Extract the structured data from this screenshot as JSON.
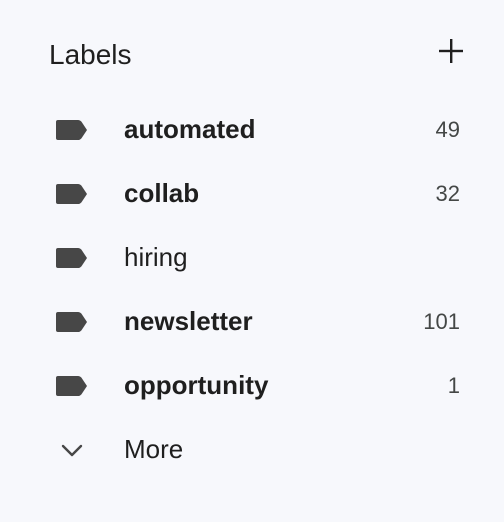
{
  "header": {
    "title": "Labels",
    "add_icon": "plus-icon"
  },
  "labels": [
    {
      "name": "automated",
      "count": "49",
      "unread": true,
      "icon": "label-tag-icon"
    },
    {
      "name": "collab",
      "count": "32",
      "unread": true,
      "icon": "label-tag-icon"
    },
    {
      "name": "hiring",
      "count": "",
      "unread": false,
      "icon": "label-tag-icon"
    },
    {
      "name": "newsletter",
      "count": "101",
      "unread": true,
      "icon": "label-tag-icon"
    },
    {
      "name": "opportunity",
      "count": "1",
      "unread": true,
      "icon": "label-tag-icon"
    }
  ],
  "more": {
    "label": "More",
    "icon": "chevron-down-icon"
  },
  "colors": {
    "background": "#f7f8fc",
    "icon": "#474747",
    "text": "#1f1f1f",
    "count": "#444746"
  }
}
